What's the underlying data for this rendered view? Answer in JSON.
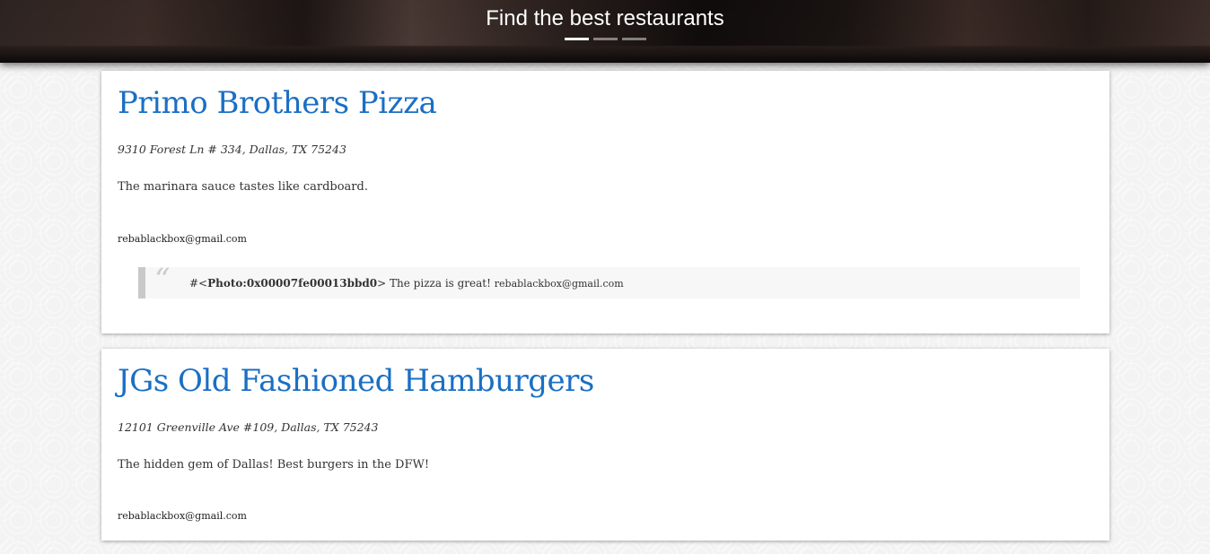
{
  "header": {
    "title": "Find the best restaurants",
    "indicators": [
      {
        "label": "slide-1",
        "active": true
      },
      {
        "label": "slide-2",
        "active": false
      },
      {
        "label": "slide-3",
        "active": false
      }
    ]
  },
  "restaurants": [
    {
      "name": "Primo Brothers Pizza",
      "address": "9310 Forest Ln # 334, Dallas, TX 75243",
      "review": "The marinara sauce tastes like cardboard.",
      "email": "rebablackbox@gmail.com",
      "comment": {
        "quote_mark": "“",
        "prefix": "#<",
        "photo": "Photo:0x00007fe00013bbd0",
        "suffix": ">",
        "text": " The pizza is great! ",
        "email": "rebablackbox@gmail.com"
      }
    },
    {
      "name": "JGs Old Fashioned Hamburgers",
      "address": "12101 Greenville Ave #109, Dallas, TX 75243",
      "review": "The hidden gem of Dallas! Best burgers in the DFW!",
      "email": "rebablackbox@gmail.com"
    }
  ],
  "colors": {
    "title_link": "#1a6fc4",
    "card_background": "#ffffff",
    "quote_border": "#c9c9c9"
  }
}
